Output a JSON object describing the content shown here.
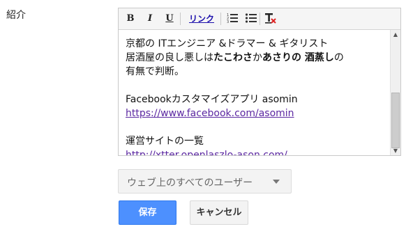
{
  "field": {
    "label": "紹介"
  },
  "toolbar": {
    "bold": "B",
    "italic": "I",
    "underline": "U",
    "link": "リンク",
    "ordered_list_icon": "numbered-list-icon",
    "bullet_list_icon": "bullet-list-icon",
    "clear_format_icon": "remove-formatting-icon"
  },
  "content": {
    "line1": "京都の ITエンジニア &ドラマー & ギタリスト",
    "line2_pre": "居酒屋の良し悪しは",
    "line2_b1": "たこわさ",
    "line2_mid": "か",
    "line2_b2": "あさりの 酒蒸し",
    "line2_post": "の",
    "line3": "有無で判断。",
    "line4": "Facebookカスタマイズアプリ asomin",
    "line5_link": "https://www.facebook.com/asomin",
    "line6": "運営サイトの一覧",
    "line7_link": "http://xtter.openlaszlo-ason.com/"
  },
  "visibility": {
    "selected": "ウェブ上のすべてのユーザー"
  },
  "buttons": {
    "save": "保存",
    "cancel": "キャンセル"
  },
  "colors": {
    "accent": "#4d90fe",
    "link": "#5b27a1"
  }
}
